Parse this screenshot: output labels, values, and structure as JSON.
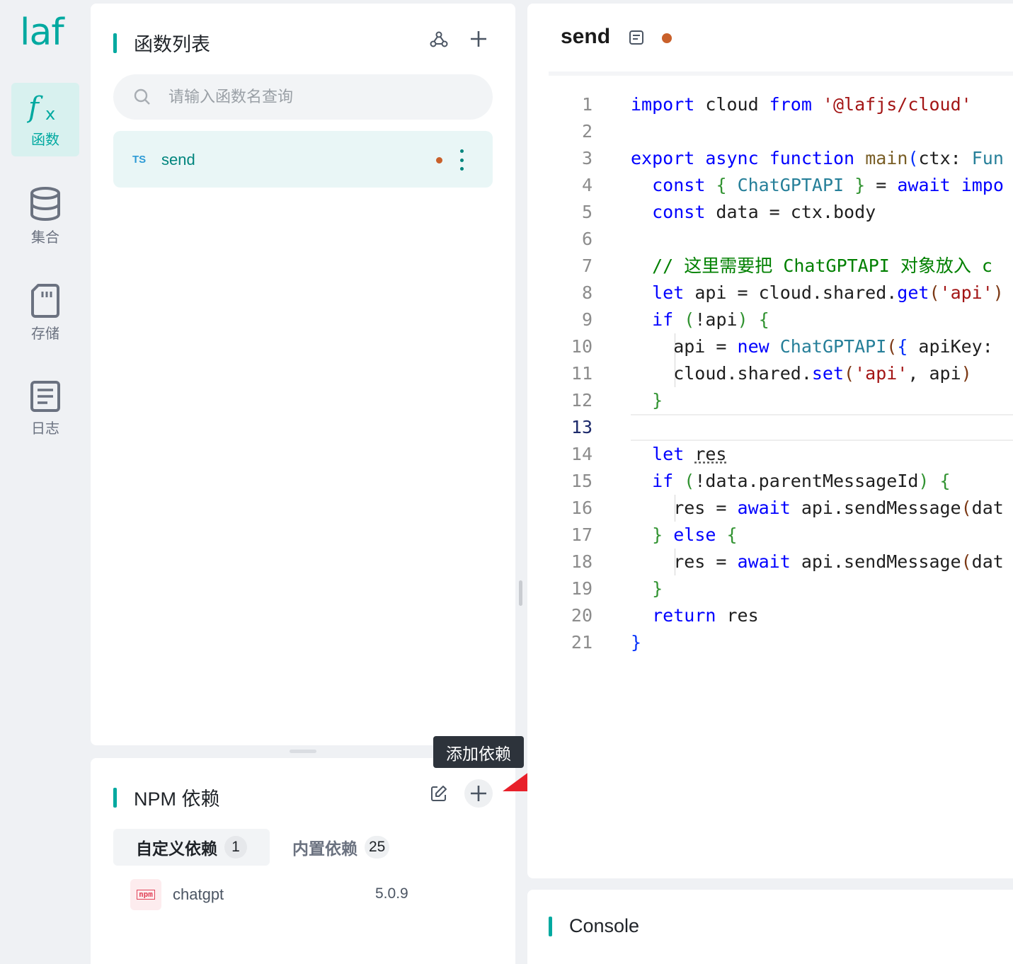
{
  "nav": {
    "logo": "laf",
    "items": [
      {
        "label": "函数",
        "icon": "function-icon",
        "active": true
      },
      {
        "label": "集合",
        "icon": "database-icon",
        "active": false
      },
      {
        "label": "存储",
        "icon": "storage-card-icon",
        "active": false
      },
      {
        "label": "日志",
        "icon": "log-document-icon",
        "active": false
      }
    ]
  },
  "functions": {
    "title": "函数列表",
    "search_placeholder": "请输入函数名查询",
    "items": [
      {
        "lang": "TS",
        "name": "send",
        "modified": true
      }
    ]
  },
  "npm": {
    "title": "NPM 依赖",
    "tooltip": "添加依赖",
    "tabs": [
      {
        "label": "自定义依赖",
        "count": "1",
        "active": true
      },
      {
        "label": "内置依赖",
        "count": "25",
        "active": false
      }
    ],
    "deps": [
      {
        "name": "chatgpt",
        "version": "5.0.9"
      }
    ]
  },
  "editor": {
    "title": "send",
    "current_line": 13,
    "line_numbers": [
      "1",
      "2",
      "3",
      "4",
      "5",
      "6",
      "7",
      "8",
      "9",
      "10",
      "11",
      "12",
      "13",
      "14",
      "15",
      "16",
      "17",
      "18",
      "19",
      "20",
      "21"
    ]
  },
  "console": {
    "title": "Console"
  },
  "colors": {
    "accent": "#00a9a0",
    "modified_dot": "#c9602a",
    "annotation_arrow": "#e8202a"
  }
}
